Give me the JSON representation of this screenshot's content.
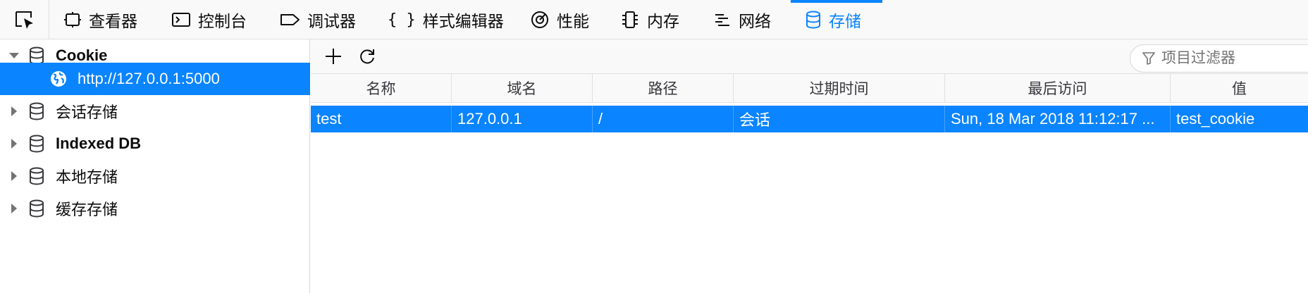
{
  "toolbar": {
    "tabs": [
      {
        "label": "查看器",
        "icon": "inspector-icon"
      },
      {
        "label": "控制台",
        "icon": "console-icon"
      },
      {
        "label": "调试器",
        "icon": "debugger-icon"
      },
      {
        "label": "样式编辑器",
        "icon": "style-editor-icon"
      },
      {
        "label": "性能",
        "icon": "performance-icon"
      },
      {
        "label": "内存",
        "icon": "memory-icon"
      },
      {
        "label": "网络",
        "icon": "network-icon"
      },
      {
        "label": "存储",
        "icon": "storage-icon"
      }
    ],
    "active_tab": "存储"
  },
  "sidebar": {
    "items": [
      {
        "label": "Cookie",
        "bold": true,
        "expanded": true
      },
      {
        "label": "http://127.0.0.1:5000",
        "selected": true,
        "child": true
      },
      {
        "label": "会话存储",
        "bold": false
      },
      {
        "label": "Indexed DB",
        "bold": true
      },
      {
        "label": "本地存储",
        "bold": false
      },
      {
        "label": "缓存存储",
        "bold": false
      }
    ]
  },
  "filter": {
    "placeholder": "项目过滤器"
  },
  "table": {
    "columns": [
      "名称",
      "域名",
      "路径",
      "过期时间",
      "最后访问",
      "值"
    ],
    "rows": [
      [
        "test",
        "127.0.0.1",
        "/",
        "会话",
        "Sun, 18 Mar 2018 11:12:17 ...",
        "test_cookie"
      ]
    ]
  },
  "colors": {
    "accent": "#0a84ff",
    "toolbar_bg": "#f9f9fa"
  }
}
